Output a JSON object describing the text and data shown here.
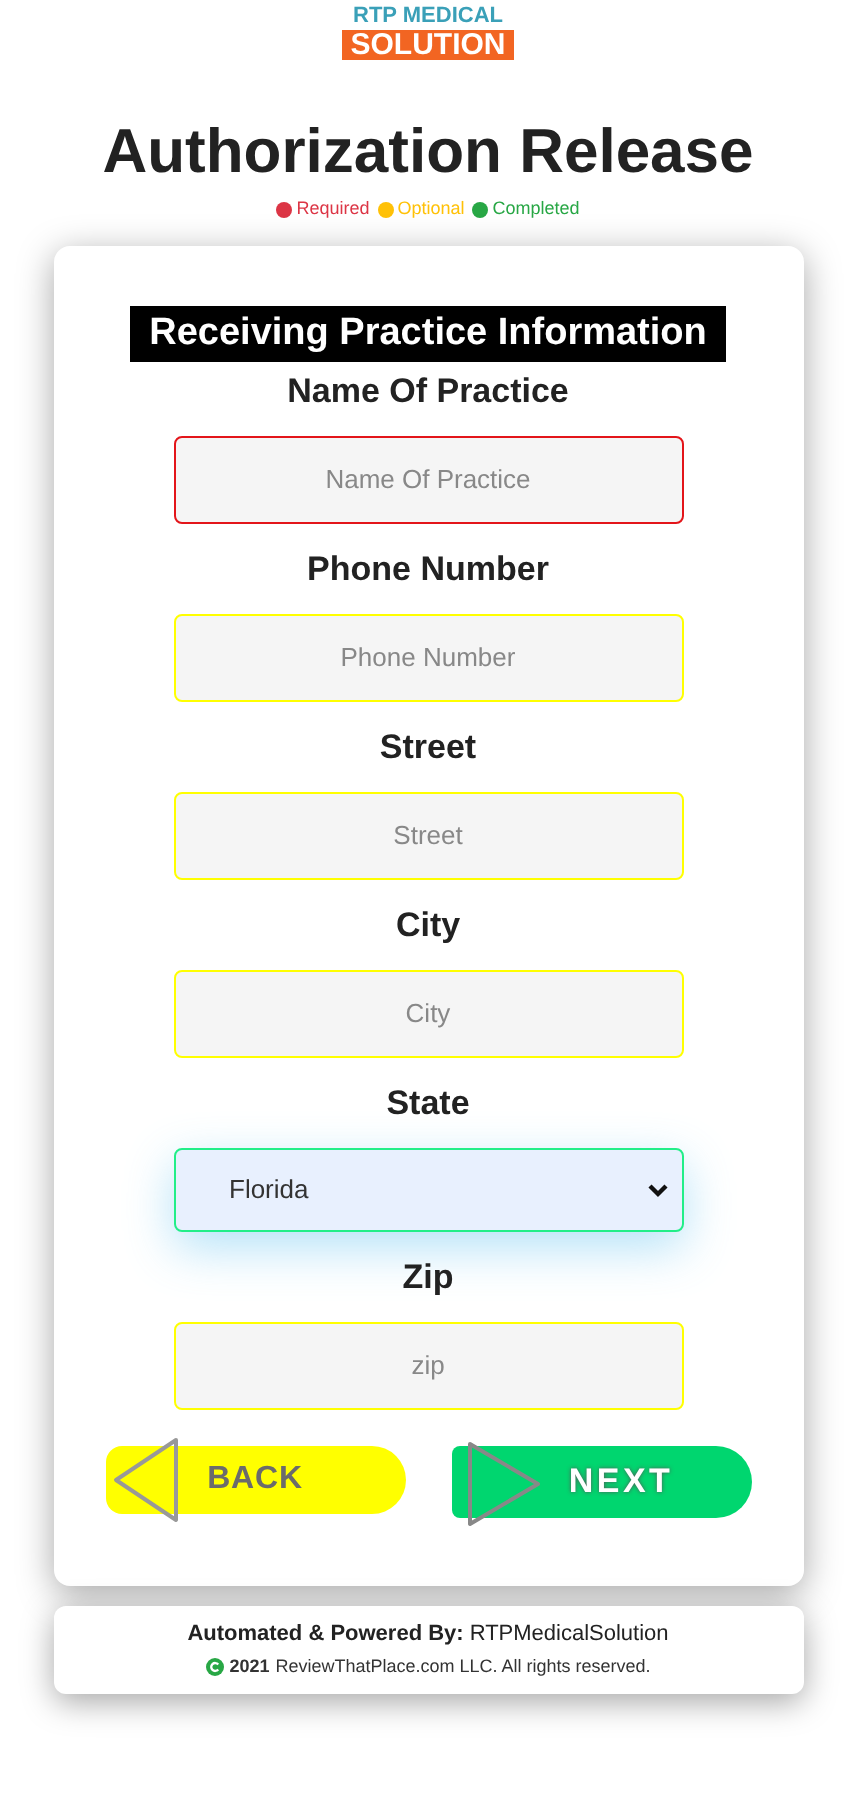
{
  "logo": {
    "line_1": "RTP MEDICAL",
    "line_2": "SOLUTION"
  },
  "title": "Authorization Release",
  "legend": [
    {
      "label": "Required",
      "color": "#dc3545"
    },
    {
      "label": "Optional",
      "color": "#ffc107"
    },
    {
      "label": "Completed",
      "color": "#28a745"
    }
  ],
  "section_title": "Receiving Practice Information",
  "fields": [
    {
      "kind": "text",
      "label": "Name Of Practice",
      "placeholder": "Name Of Practice",
      "color": "#e3151a"
    },
    {
      "kind": "text",
      "label": "Phone Number",
      "placeholder": "Phone Number",
      "color": "#ffff00"
    },
    {
      "kind": "text",
      "label": "Street",
      "placeholder": "Street",
      "color": "#ffff00"
    },
    {
      "kind": "text",
      "label": "City",
      "placeholder": "City",
      "color": "#ffff00"
    },
    {
      "kind": "select",
      "label": "State",
      "value": "Florida",
      "color": "#22ee88"
    },
    {
      "kind": "text",
      "label": "Zip",
      "placeholder": "zip",
      "color": "#ffff00"
    }
  ],
  "buttons": {
    "back": "BACK",
    "next": "NEXT"
  },
  "footer": {
    "powered_label": "Automated & Powered By:",
    "powered_value": "RTPMedicalSolution",
    "copyright_year": "2021",
    "copyright_text": "ReviewThatPlace.com LLC. All rights reserved."
  }
}
